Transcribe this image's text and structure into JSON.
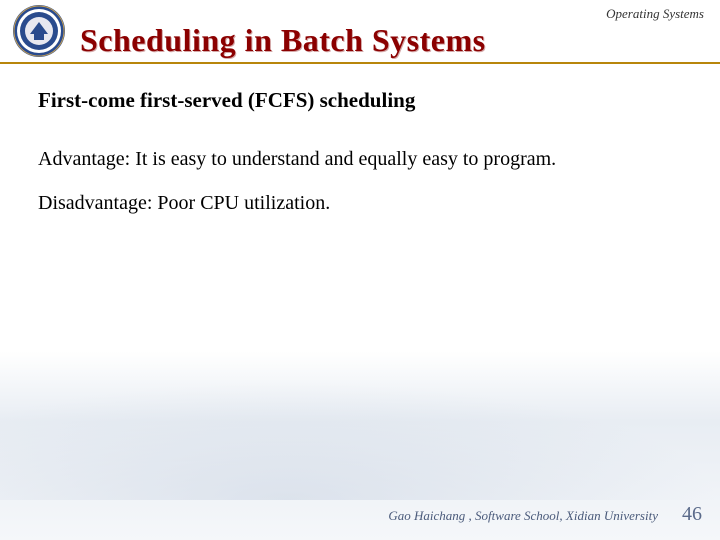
{
  "header": {
    "course_label": "Operating Systems",
    "title": "Scheduling in Batch Systems"
  },
  "content": {
    "subtitle": "First-come first-served (FCFS) scheduling",
    "advantage": "Advantage: It is easy to understand and equally easy to program.",
    "disadvantage": "Disadvantage: Poor CPU utilization."
  },
  "footer": {
    "affiliation": "Gao Haichang , Software School, Xidian University",
    "page_number": "46"
  },
  "logo": {
    "outer_color": "#2a4b8d",
    "inner_color": "#ffffff",
    "accent": "#c9a050"
  }
}
